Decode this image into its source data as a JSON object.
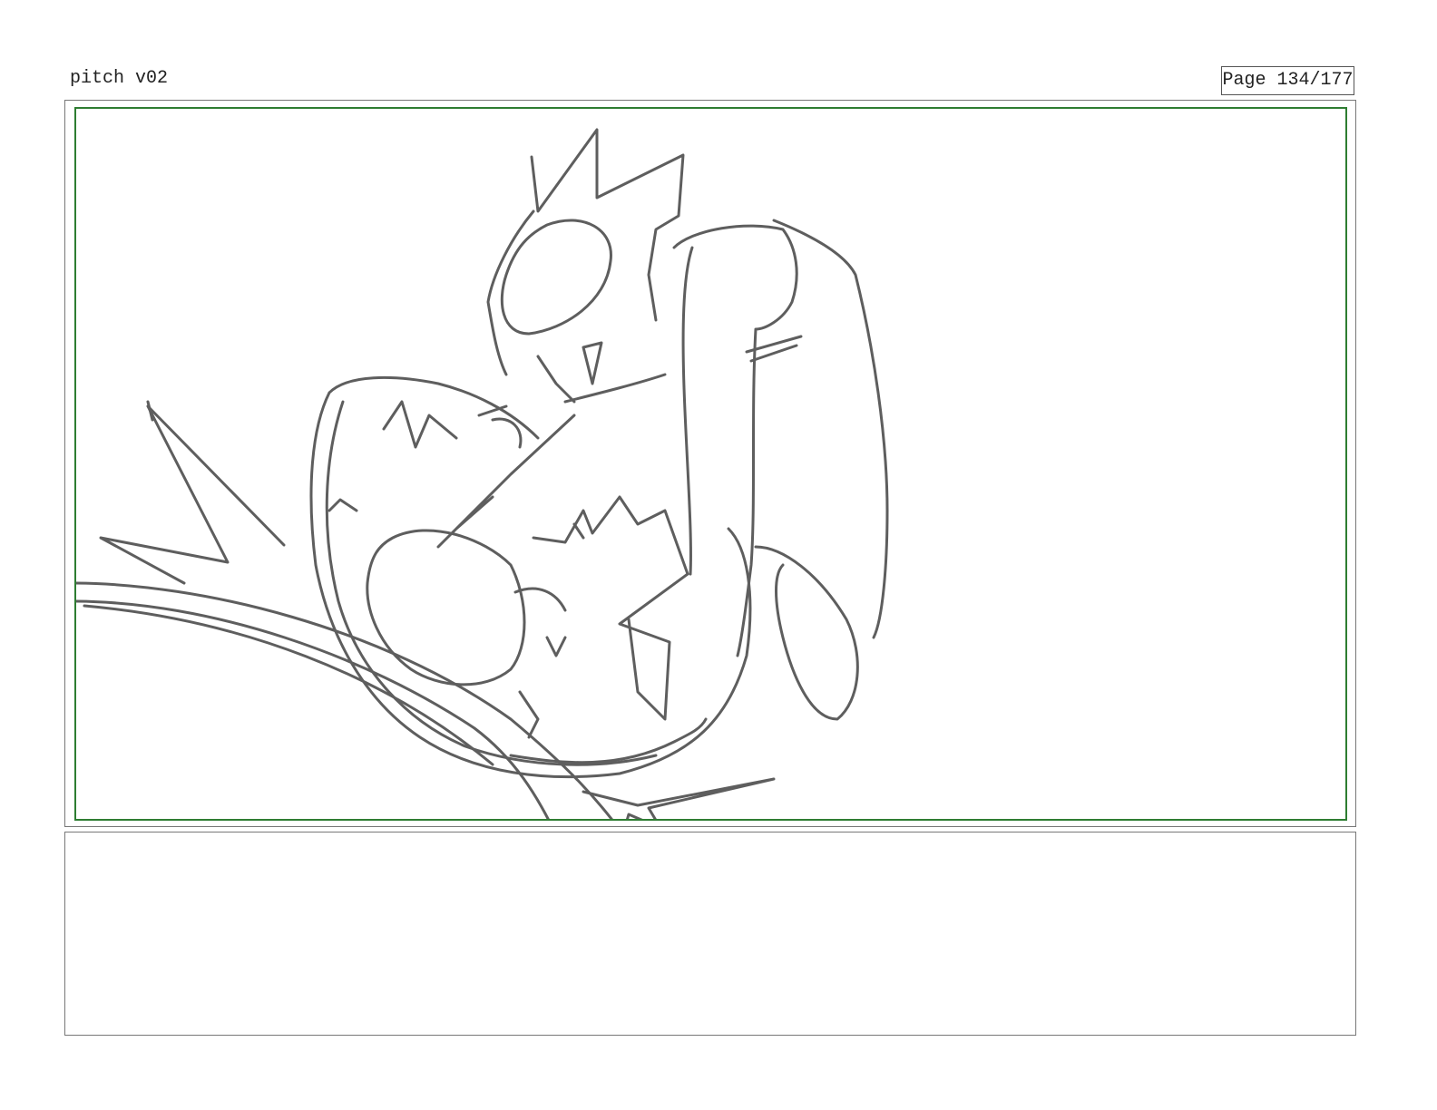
{
  "header": {
    "title": "pitch v02",
    "page_label": "Page 134/177"
  },
  "panel": {
    "safe_area_color": "#2e7d32",
    "sketch_stroke_color": "#5e5e5e"
  },
  "notes": {
    "text": ""
  }
}
